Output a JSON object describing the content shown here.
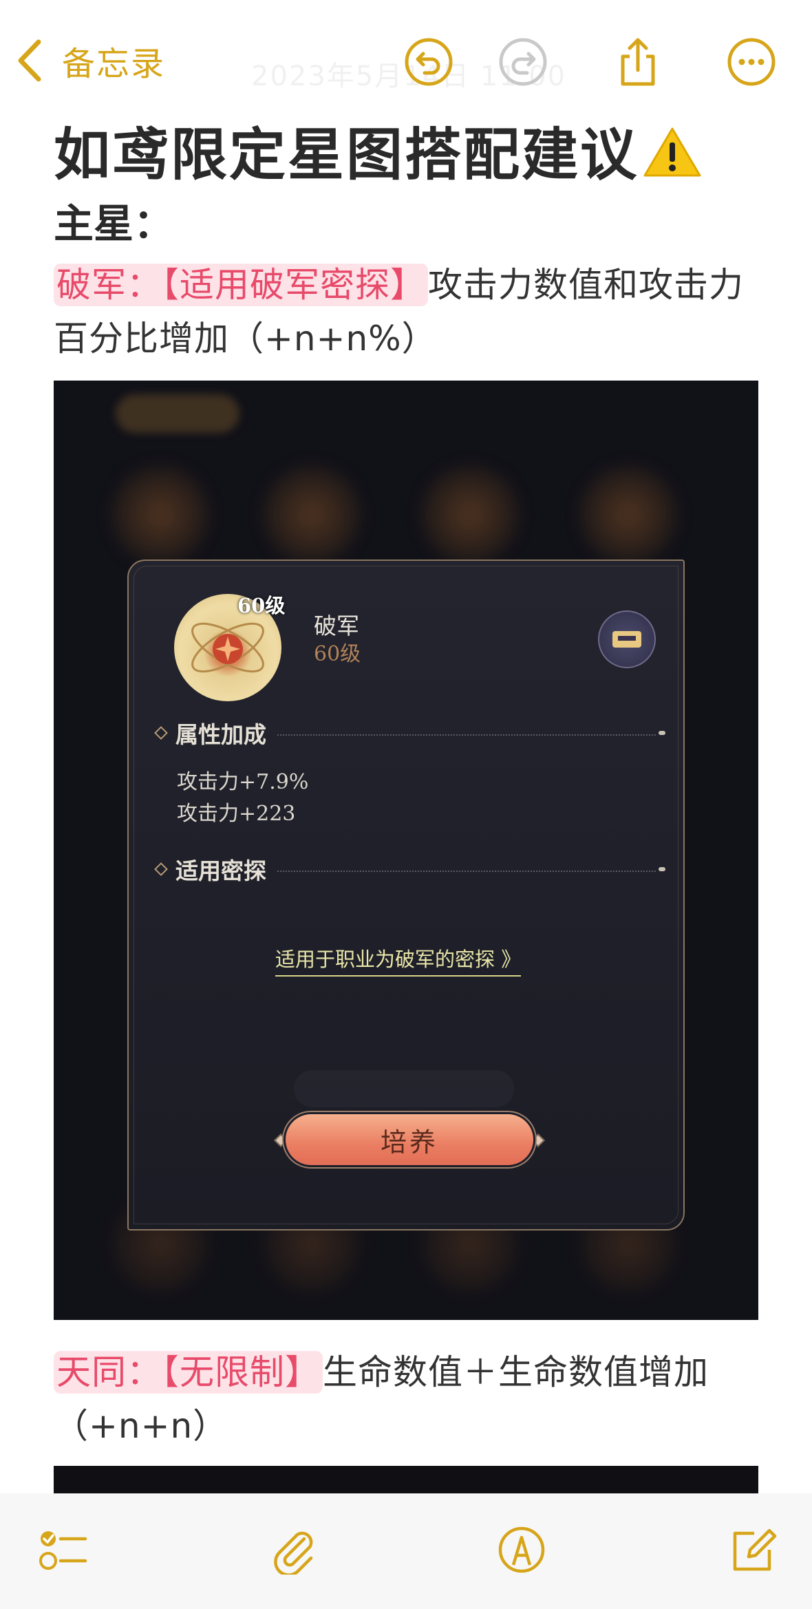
{
  "nav": {
    "back_label": "备忘录",
    "ghost_date": "2023年5月14日 11:00"
  },
  "note": {
    "title": "如鸢限定星图搭配建议",
    "subhead": "主星：",
    "p1_highlight": "破军：【适用破军密探】",
    "p1_rest": "攻击力数值和攻击力百分比增加（+n+n%）",
    "p2_highlight": "天同：【无限制】",
    "p2_rest": "生命数值＋生命数值增加（+n+n）"
  },
  "game": {
    "medal_level": "60级",
    "star_name": "破军",
    "star_level": "60级",
    "section_attr": "属性加成",
    "attr_1": "攻击力+7.9%",
    "attr_2": "攻击力+223",
    "section_detective": "适用密探",
    "career_link": "适用于职业为破军的密探 》",
    "train_button": "培养"
  },
  "colors": {
    "accent": "#d7a519",
    "highlight_bg": "#fde3e8",
    "highlight_text": "#e84a6a"
  }
}
